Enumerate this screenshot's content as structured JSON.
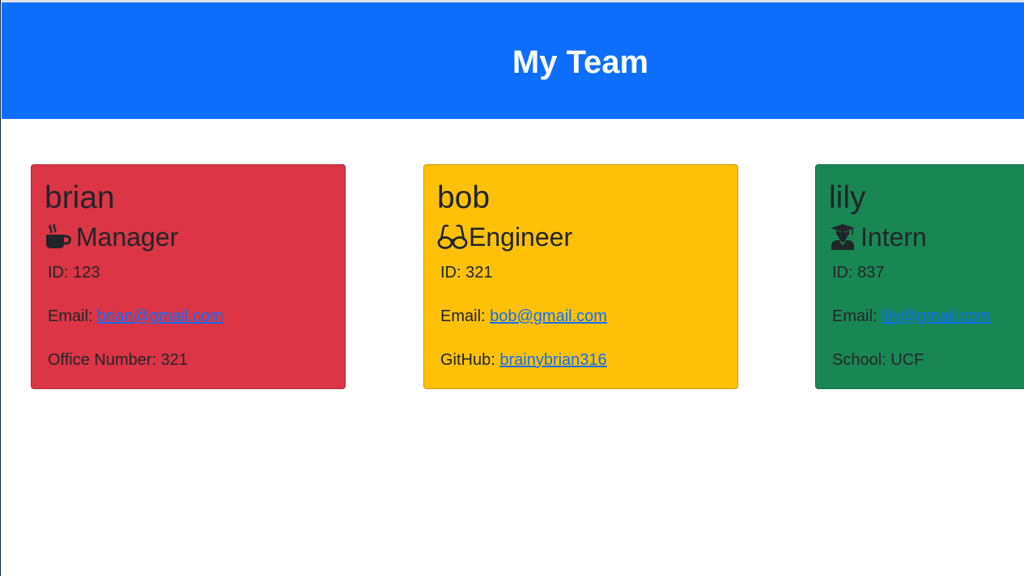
{
  "header": {
    "title": "My Team"
  },
  "cards": [
    {
      "name": "brian",
      "role": "Manager",
      "icon": "mug-hot-icon",
      "color": "#dc3545",
      "id_text": "ID: 123",
      "email_label": "Email: ",
      "email": "brian@gmail.com",
      "extra_label": "Office Number: 321",
      "extra_link": ""
    },
    {
      "name": "bob",
      "role": "Engineer",
      "icon": "glasses-icon",
      "color": "#ffc107",
      "id_text": "ID: 321",
      "email_label": "Email: ",
      "email": "bob@gmail.com",
      "extra_label": "GitHub: ",
      "extra_link": "brainybrian316"
    },
    {
      "name": "lily",
      "role": "Intern",
      "icon": "graduate-icon",
      "color": "#198754",
      "id_text": "ID: 837",
      "email_label": "Email: ",
      "email": "lily@gmail.com",
      "extra_label": "School: UCF",
      "extra_link": ""
    }
  ]
}
